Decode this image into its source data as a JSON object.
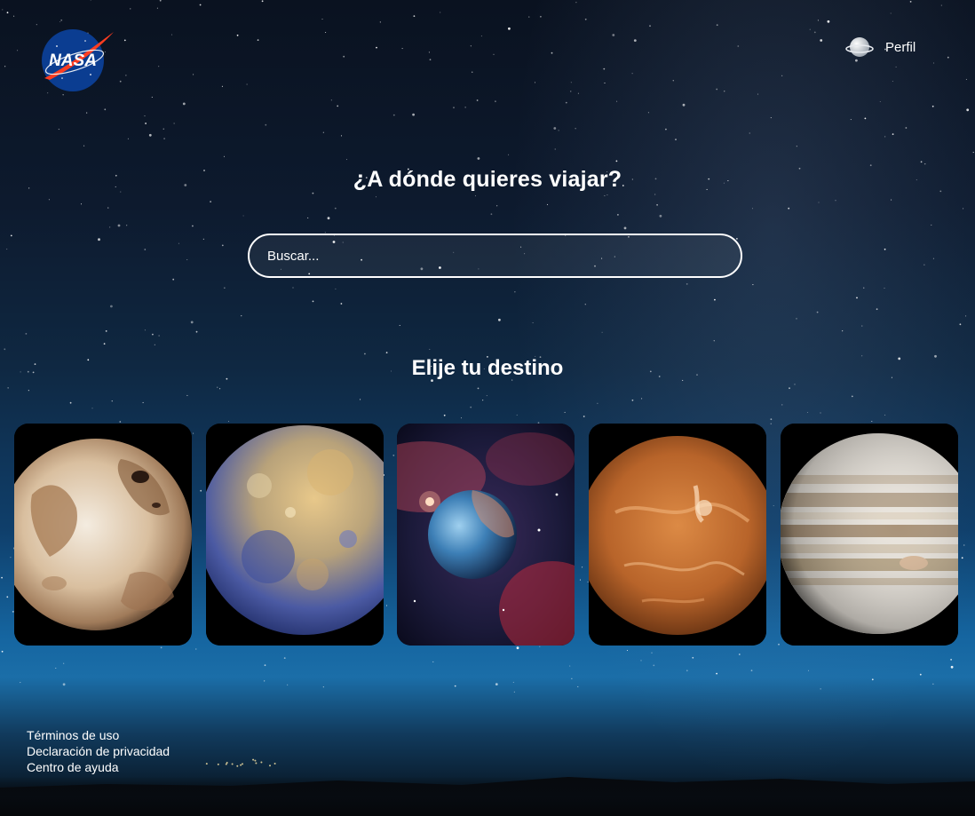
{
  "header": {
    "logo_text": "NASA",
    "profile_label": "Perfil",
    "profile_icon": "planet-icon"
  },
  "hero": {
    "title": "¿A dónde quieres viajar?",
    "search_placeholder": "Buscar..."
  },
  "destinations": {
    "title": "Elije tu destino",
    "cards": [
      {
        "image": "pluto-planet-image"
      },
      {
        "image": "mercury-planet-image"
      },
      {
        "image": "exoplanet-nebula-image"
      },
      {
        "image": "venus-planet-image"
      },
      {
        "image": "jupiter-planet-image"
      }
    ]
  },
  "footer": {
    "links": [
      "Términos de uso",
      "Declaración de privacidad",
      "Centro de ayuda"
    ]
  },
  "colors": {
    "sky_top": "#0a1220",
    "sky_horizon": "#1565a0",
    "text": "#ffffff",
    "nasa_blue": "#0b3d91",
    "nasa_red": "#fc3d21"
  }
}
